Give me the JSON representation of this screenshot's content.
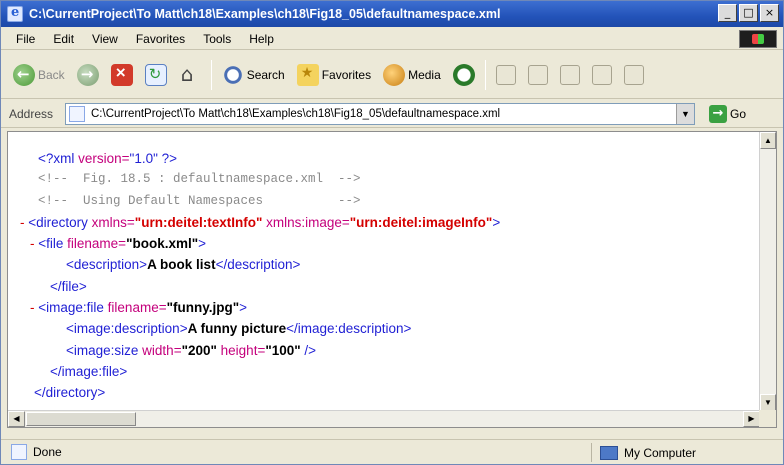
{
  "window": {
    "title": "C:\\CurrentProject\\To Matt\\ch18\\Examples\\ch18\\Fig18_05\\defaultnamespace.xml",
    "minimize": "_",
    "maximize": "□",
    "close": "×"
  },
  "menu": [
    "File",
    "Edit",
    "View",
    "Favorites",
    "Tools",
    "Help"
  ],
  "toolbar": {
    "back": "Back",
    "search": "Search",
    "favorites": "Favorites",
    "media": "Media"
  },
  "address": {
    "label": "Address",
    "value": "C:\\CurrentProject\\To Matt\\ch18\\Examples\\ch18\\Fig18_05\\defaultnamespace.xml",
    "go": "Go"
  },
  "xml": {
    "line1": {
      "open": "<?xml",
      "attr": " version=",
      "val": "\"1.0\"",
      "close": " ?>"
    },
    "line2": "<!--  Fig. 18.5 : defaultnamespace.xml  -->",
    "line3": "<!--  Using Default Namespaces          -->",
    "line4": {
      "minus": "- ",
      "open": "<directory",
      "a1": " xmlns=",
      "v1": "\"urn:deitel:textInfo\"",
      "a2": " xmlns:image=",
      "v2": "\"urn:deitel:imageInfo\"",
      "close": ">"
    },
    "line5": {
      "minus": "- ",
      "open": "<file",
      "a1": " filename=",
      "v1": "\"book.xml\"",
      "close": ">"
    },
    "line6": {
      "open": "<description>",
      "text": "A book list",
      "close": "</description>"
    },
    "line7": "</file>",
    "line8": {
      "minus": "- ",
      "open": "<image:file",
      "a1": " filename=",
      "v1": "\"funny.jpg\"",
      "close": ">"
    },
    "line9": {
      "open": "<image:description>",
      "text": "A funny picture",
      "close": "</image:description>"
    },
    "line10": {
      "open": "<image:size",
      "a1": " width=",
      "v1": "\"200\"",
      "a2": " height=",
      "v2": "\"100\"",
      "close": " />"
    },
    "line11": "</image:file>",
    "line12": "</directory>"
  },
  "status": {
    "text": "Done",
    "zone": "My Computer"
  }
}
